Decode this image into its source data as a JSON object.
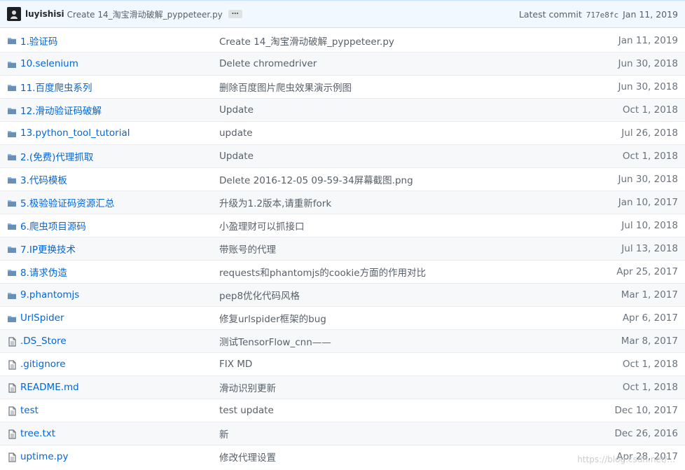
{
  "commit": {
    "author": "luyishisi",
    "message": "Create 14_淘宝滑动破解_pyppeteer.py",
    "ellipsis": "…",
    "latest_label": "Latest commit",
    "sha": "717e8fc",
    "date": "Jan 11, 2019"
  },
  "colors": {
    "link": "#0366d6",
    "folder": "#79b8ff",
    "file": "#6a737d",
    "header_bg": "#f1f8ff"
  },
  "files": [
    {
      "type": "folder",
      "name": "1.验证码",
      "message": "Create 14_淘宝滑动破解_pyppeteer.py",
      "age": "Jan 11, 2019"
    },
    {
      "type": "folder",
      "name": "10.selenium",
      "message": "Delete chromedriver",
      "age": "Jun 30, 2018"
    },
    {
      "type": "folder",
      "name": "11.百度爬虫系列",
      "message": "删除百度图片爬虫效果演示例图",
      "age": "Jun 30, 2018"
    },
    {
      "type": "folder",
      "name": "12.滑动验证码破解",
      "message": "Update",
      "age": "Oct 1, 2018"
    },
    {
      "type": "folder",
      "name": "13.python_tool_tutorial",
      "message": "update",
      "age": "Jul 26, 2018"
    },
    {
      "type": "folder",
      "name": "2.(免费)代理抓取",
      "message": "Update",
      "age": "Oct 1, 2018"
    },
    {
      "type": "folder",
      "name": "3.代码模板",
      "message": "Delete 2016-12-05 09-59-34屏幕截图.png",
      "age": "Jun 30, 2018"
    },
    {
      "type": "folder",
      "name": "5.极验验证码资源汇总",
      "message": "升级为1.2版本,请重新fork",
      "age": "Jan 10, 2017"
    },
    {
      "type": "folder",
      "name": "6.爬虫项目源码",
      "message": "小盈理财可以抓接口",
      "age": "Jul 10, 2018"
    },
    {
      "type": "folder",
      "name": "7.IP更换技术",
      "message": "带账号的代理",
      "age": "Jul 13, 2018"
    },
    {
      "type": "folder",
      "name": "8.请求伪造",
      "message": "requests和phantomjs的cookie方面的作用对比",
      "age": "Apr 25, 2017"
    },
    {
      "type": "folder",
      "name": "9.phantomjs",
      "message": "pep8优化代码风格",
      "age": "Mar 1, 2017"
    },
    {
      "type": "folder",
      "name": "UrlSpider",
      "message": "修复urlspider框架的bug",
      "age": "Apr 6, 2017"
    },
    {
      "type": "file",
      "name": ".DS_Store",
      "message": "测试TensorFlow_cnn——",
      "age": "Mar 8, 2017"
    },
    {
      "type": "file",
      "name": ".gitignore",
      "message": "FIX MD",
      "age": "Oct 1, 2018"
    },
    {
      "type": "file",
      "name": "README.md",
      "message": "滑动识别更新",
      "age": "Oct 1, 2018"
    },
    {
      "type": "file",
      "name": "test",
      "message": "test update",
      "age": "Dec 10, 2017"
    },
    {
      "type": "file",
      "name": "tree.txt",
      "message": "新",
      "age": "Dec 26, 2016"
    },
    {
      "type": "file",
      "name": "uptime.py",
      "message": "修改代理设置",
      "age": "Apr 28, 2017"
    }
  ],
  "watermark": "https://blog.csdn.net/..."
}
